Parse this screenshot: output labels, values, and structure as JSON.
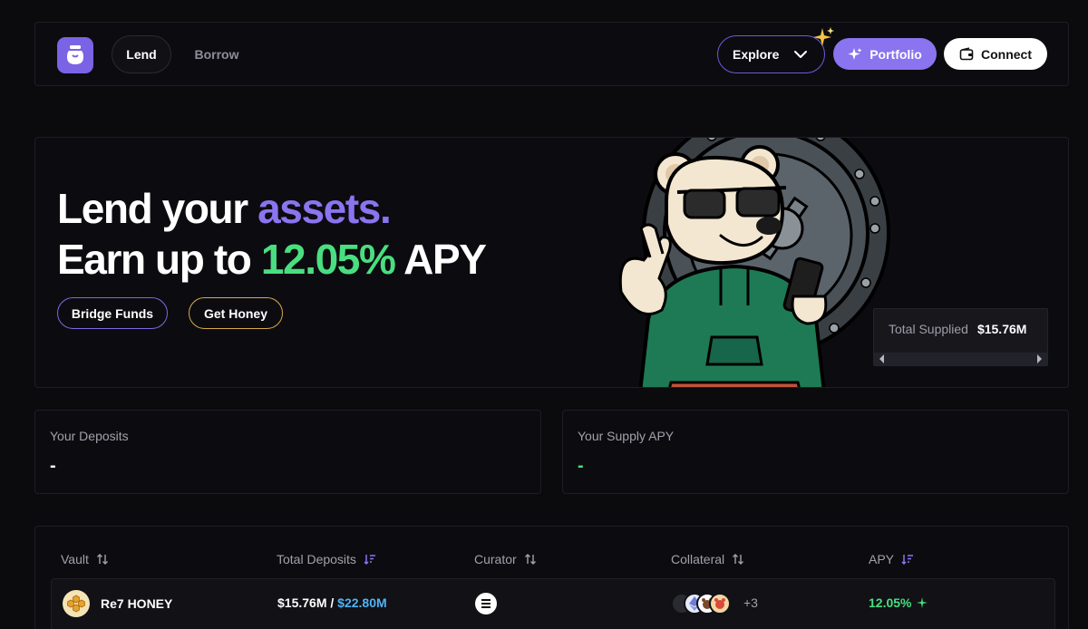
{
  "nav": {
    "tabs": [
      {
        "label": "Lend",
        "active": true
      },
      {
        "label": "Borrow",
        "active": false
      }
    ],
    "explore_label": "Explore",
    "portfolio_label": "Portfolio",
    "connect_label": "Connect"
  },
  "hero": {
    "line1_prefix": "Lend your ",
    "line1_highlight": "assets.",
    "line2_prefix": "Earn up to ",
    "line2_highlight": "12.05%",
    "line2_suffix": " APY",
    "bridge_label": "Bridge Funds",
    "honey_label": "Get Honey",
    "total_supplied_label": "Total Supplied",
    "total_supplied_value": "$15.76M"
  },
  "stats": {
    "deposits_label": "Your Deposits",
    "deposits_value": "-",
    "apy_label": "Your Supply APY",
    "apy_value": "-"
  },
  "table": {
    "columns": [
      "Vault",
      "Total Deposits",
      "Curator",
      "Collateral",
      "APY"
    ],
    "rows": [
      {
        "vault": "Re7 HONEY",
        "deposits": "$15.76M",
        "separator": " / ",
        "capacity": "$22.80M",
        "collateral_icons": [
          "token-icon",
          "ethereum-icon",
          "bear-token-icon",
          "bera-token-icon"
        ],
        "collateral_more": "+3",
        "apy": "12.05%"
      }
    ]
  },
  "colors": {
    "background": "#0b0b0e",
    "accent_purple": "#8b74ef",
    "accent_green": "#4ade80",
    "accent_blue": "#4fb3f5",
    "honey_gold": "#d9a94a"
  }
}
